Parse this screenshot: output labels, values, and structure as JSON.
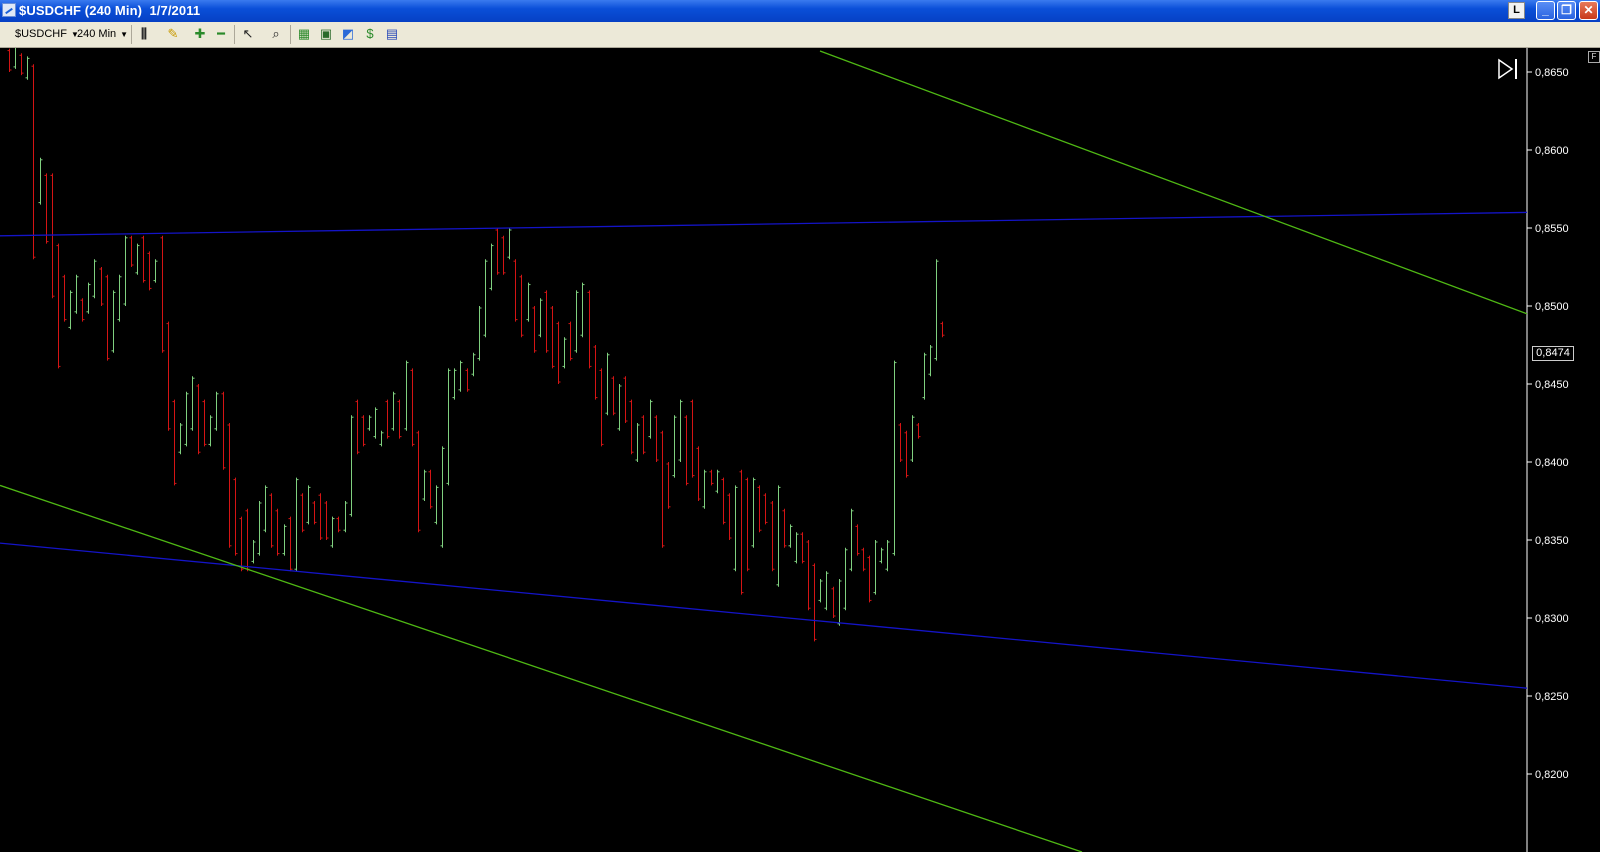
{
  "window": {
    "title": "$USDCHF (240 Min)  1/7/2011",
    "l_button": "L"
  },
  "toolbar": {
    "symbol": "$USDCHF",
    "interval": "240 Min"
  },
  "chart": {
    "last_price": "0,8474",
    "f_button": "F"
  },
  "colors": {
    "up_bar": "#7fd07f",
    "down_bar": "#d41414",
    "trendline_blue": "#1414c8",
    "trendline_green": "#4fb814",
    "axis_text": "#ffffff",
    "background": "#000000"
  },
  "icons": [
    "chart-icon",
    "bar-type-icon",
    "pencil-icon",
    "zoom-in-icon",
    "zoom-out-icon",
    "cursor-icon",
    "magnifier-icon",
    "insert-strategy-icon",
    "insert-indicator-icon",
    "chart-analysis-icon",
    "dollar-icon",
    "format-window-icon",
    "play-end-icon"
  ],
  "chart_data": {
    "type": "ohlc",
    "ylim": [
      0.8175,
      0.868
    ],
    "y_ticks": [
      "0,8650",
      "0,8600",
      "0,8550",
      "0,8500",
      "0,8450",
      "0,8400",
      "0,8350",
      "0,8300",
      "0,8250",
      "0,8200"
    ],
    "bars": [
      [
        0.8665,
        0.865,
        "d"
      ],
      [
        0.8668,
        0.8652,
        "u"
      ],
      [
        0.8662,
        0.8648,
        "d"
      ],
      [
        0.866,
        0.8645,
        "u"
      ],
      [
        0.8655,
        0.853,
        "d"
      ],
      [
        0.8595,
        0.8565,
        "u"
      ],
      [
        0.8585,
        0.854,
        "d"
      ],
      [
        0.8585,
        0.8505,
        "d"
      ],
      [
        0.854,
        0.846,
        "d"
      ],
      [
        0.852,
        0.849,
        "d"
      ],
      [
        0.851,
        0.8485,
        "u"
      ],
      [
        0.852,
        0.8495,
        "u"
      ],
      [
        0.8505,
        0.849,
        "d"
      ],
      [
        0.8515,
        0.8495,
        "u"
      ],
      [
        0.853,
        0.8505,
        "u"
      ],
      [
        0.8525,
        0.85,
        "d"
      ],
      [
        0.852,
        0.8465,
        "d"
      ],
      [
        0.851,
        0.847,
        "u"
      ],
      [
        0.852,
        0.849,
        "u"
      ],
      [
        0.8545,
        0.85,
        "u"
      ],
      [
        0.8545,
        0.8525,
        "d"
      ],
      [
        0.854,
        0.852,
        "u"
      ],
      [
        0.8545,
        0.8515,
        "d"
      ],
      [
        0.8535,
        0.851,
        "d"
      ],
      [
        0.853,
        0.8515,
        "u"
      ],
      [
        0.8545,
        0.847,
        "d"
      ],
      [
        0.849,
        0.842,
        "d"
      ],
      [
        0.844,
        0.8385,
        "d"
      ],
      [
        0.8425,
        0.8405,
        "u"
      ],
      [
        0.8445,
        0.841,
        "u"
      ],
      [
        0.8455,
        0.842,
        "u"
      ],
      [
        0.845,
        0.8405,
        "d"
      ],
      [
        0.844,
        0.841,
        "d"
      ],
      [
        0.843,
        0.841,
        "u"
      ],
      [
        0.8445,
        0.842,
        "u"
      ],
      [
        0.8445,
        0.8395,
        "d"
      ],
      [
        0.8425,
        0.8345,
        "d"
      ],
      [
        0.839,
        0.834,
        "d"
      ],
      [
        0.8365,
        0.833,
        "d"
      ],
      [
        0.837,
        0.833,
        "d"
      ],
      [
        0.835,
        0.8335,
        "u"
      ],
      [
        0.8375,
        0.834,
        "u"
      ],
      [
        0.8385,
        0.8355,
        "u"
      ],
      [
        0.838,
        0.8345,
        "d"
      ],
      [
        0.837,
        0.834,
        "d"
      ],
      [
        0.836,
        0.834,
        "u"
      ],
      [
        0.8365,
        0.833,
        "d"
      ],
      [
        0.839,
        0.833,
        "u"
      ],
      [
        0.838,
        0.8355,
        "d"
      ],
      [
        0.8385,
        0.836,
        "u"
      ],
      [
        0.8375,
        0.836,
        "d"
      ],
      [
        0.838,
        0.835,
        "d"
      ],
      [
        0.8375,
        0.835,
        "d"
      ],
      [
        0.8365,
        0.8345,
        "u"
      ],
      [
        0.8365,
        0.8355,
        "d"
      ],
      [
        0.8375,
        0.8355,
        "u"
      ],
      [
        0.843,
        0.8365,
        "u"
      ],
      [
        0.844,
        0.8405,
        "d"
      ],
      [
        0.843,
        0.841,
        "d"
      ],
      [
        0.843,
        0.842,
        "u"
      ],
      [
        0.8435,
        0.8415,
        "u"
      ],
      [
        0.842,
        0.841,
        "u"
      ],
      [
        0.844,
        0.8415,
        "d"
      ],
      [
        0.8445,
        0.842,
        "u"
      ],
      [
        0.844,
        0.8415,
        "d"
      ],
      [
        0.8465,
        0.842,
        "u"
      ],
      [
        0.846,
        0.841,
        "d"
      ],
      [
        0.842,
        0.8355,
        "d"
      ],
      [
        0.8395,
        0.8375,
        "u"
      ],
      [
        0.8395,
        0.837,
        "d"
      ],
      [
        0.8385,
        0.836,
        "u"
      ],
      [
        0.841,
        0.8345,
        "u"
      ],
      [
        0.846,
        0.8385,
        "u"
      ],
      [
        0.846,
        0.844,
        "u"
      ],
      [
        0.8465,
        0.8445,
        "u"
      ],
      [
        0.846,
        0.8445,
        "d"
      ],
      [
        0.847,
        0.8455,
        "u"
      ],
      [
        0.85,
        0.8465,
        "u"
      ],
      [
        0.853,
        0.848,
        "u"
      ],
      [
        0.854,
        0.851,
        "u"
      ],
      [
        0.855,
        0.852,
        "d"
      ],
      [
        0.8545,
        0.852,
        "d"
      ],
      [
        0.855,
        0.853,
        "u"
      ],
      [
        0.853,
        0.849,
        "d"
      ],
      [
        0.852,
        0.848,
        "d"
      ],
      [
        0.8515,
        0.849,
        "u"
      ],
      [
        0.85,
        0.847,
        "d"
      ],
      [
        0.8505,
        0.848,
        "u"
      ],
      [
        0.851,
        0.847,
        "d"
      ],
      [
        0.85,
        0.846,
        "d"
      ],
      [
        0.849,
        0.845,
        "d"
      ],
      [
        0.848,
        0.846,
        "u"
      ],
      [
        0.849,
        0.8465,
        "d"
      ],
      [
        0.851,
        0.847,
        "u"
      ],
      [
        0.8515,
        0.848,
        "u"
      ],
      [
        0.851,
        0.846,
        "d"
      ],
      [
        0.8475,
        0.844,
        "d"
      ],
      [
        0.846,
        0.841,
        "d"
      ],
      [
        0.847,
        0.843,
        "u"
      ],
      [
        0.8455,
        0.843,
        "d"
      ],
      [
        0.845,
        0.842,
        "u"
      ],
      [
        0.8455,
        0.8425,
        "d"
      ],
      [
        0.844,
        0.8405,
        "d"
      ],
      [
        0.8425,
        0.84,
        "u"
      ],
      [
        0.843,
        0.8405,
        "d"
      ],
      [
        0.844,
        0.8415,
        "u"
      ],
      [
        0.843,
        0.84,
        "d"
      ],
      [
        0.842,
        0.8345,
        "d"
      ],
      [
        0.84,
        0.837,
        "d"
      ],
      [
        0.843,
        0.839,
        "u"
      ],
      [
        0.844,
        0.84,
        "u"
      ],
      [
        0.843,
        0.8385,
        "d"
      ],
      [
        0.844,
        0.839,
        "d"
      ],
      [
        0.841,
        0.8375,
        "d"
      ],
      [
        0.8395,
        0.837,
        "u"
      ],
      [
        0.8395,
        0.8385,
        "d"
      ],
      [
        0.8395,
        0.838,
        "u"
      ],
      [
        0.839,
        0.836,
        "d"
      ],
      [
        0.838,
        0.835,
        "d"
      ],
      [
        0.8385,
        0.833,
        "u"
      ],
      [
        0.8395,
        0.8315,
        "d"
      ],
      [
        0.839,
        0.833,
        "d"
      ],
      [
        0.839,
        0.8345,
        "u"
      ],
      [
        0.8385,
        0.8355,
        "d"
      ],
      [
        0.838,
        0.836,
        "d"
      ],
      [
        0.8375,
        0.833,
        "d"
      ],
      [
        0.8385,
        0.832,
        "u"
      ],
      [
        0.837,
        0.8345,
        "d"
      ],
      [
        0.836,
        0.8345,
        "u"
      ],
      [
        0.8355,
        0.8335,
        "u"
      ],
      [
        0.8355,
        0.8335,
        "d"
      ],
      [
        0.835,
        0.8305,
        "d"
      ],
      [
        0.8335,
        0.8285,
        "d"
      ],
      [
        0.8325,
        0.831,
        "u"
      ],
      [
        0.833,
        0.8305,
        "u"
      ],
      [
        0.832,
        0.83,
        "d"
      ],
      [
        0.8325,
        0.8295,
        "u"
      ],
      [
        0.8345,
        0.8305,
        "u"
      ],
      [
        0.837,
        0.833,
        "u"
      ],
      [
        0.836,
        0.834,
        "d"
      ],
      [
        0.8345,
        0.833,
        "d"
      ],
      [
        0.834,
        0.831,
        "d"
      ],
      [
        0.835,
        0.8315,
        "u"
      ],
      [
        0.8345,
        0.8335,
        "u"
      ],
      [
        0.835,
        0.833,
        "u"
      ],
      [
        0.8465,
        0.834,
        "u"
      ],
      [
        0.8425,
        0.84,
        "d"
      ],
      [
        0.842,
        0.839,
        "d"
      ],
      [
        0.843,
        0.84,
        "u"
      ],
      [
        0.8425,
        0.8415,
        "d"
      ],
      [
        0.847,
        0.844,
        "u"
      ],
      [
        0.8475,
        0.8455,
        "u"
      ],
      [
        0.853,
        0.8465,
        "u"
      ],
      [
        0.849,
        0.848,
        "d"
      ]
    ],
    "lines": [
      {
        "color": "blue",
        "y1": 0.8545,
        "y2": 0.856
      },
      {
        "color": "blue",
        "y1": 0.8348,
        "y2": 0.8255
      },
      {
        "color": "green",
        "from": "top",
        "y2": 0.8495
      },
      {
        "color": "green",
        "y1": 0.8385,
        "to": "bottom"
      }
    ]
  }
}
